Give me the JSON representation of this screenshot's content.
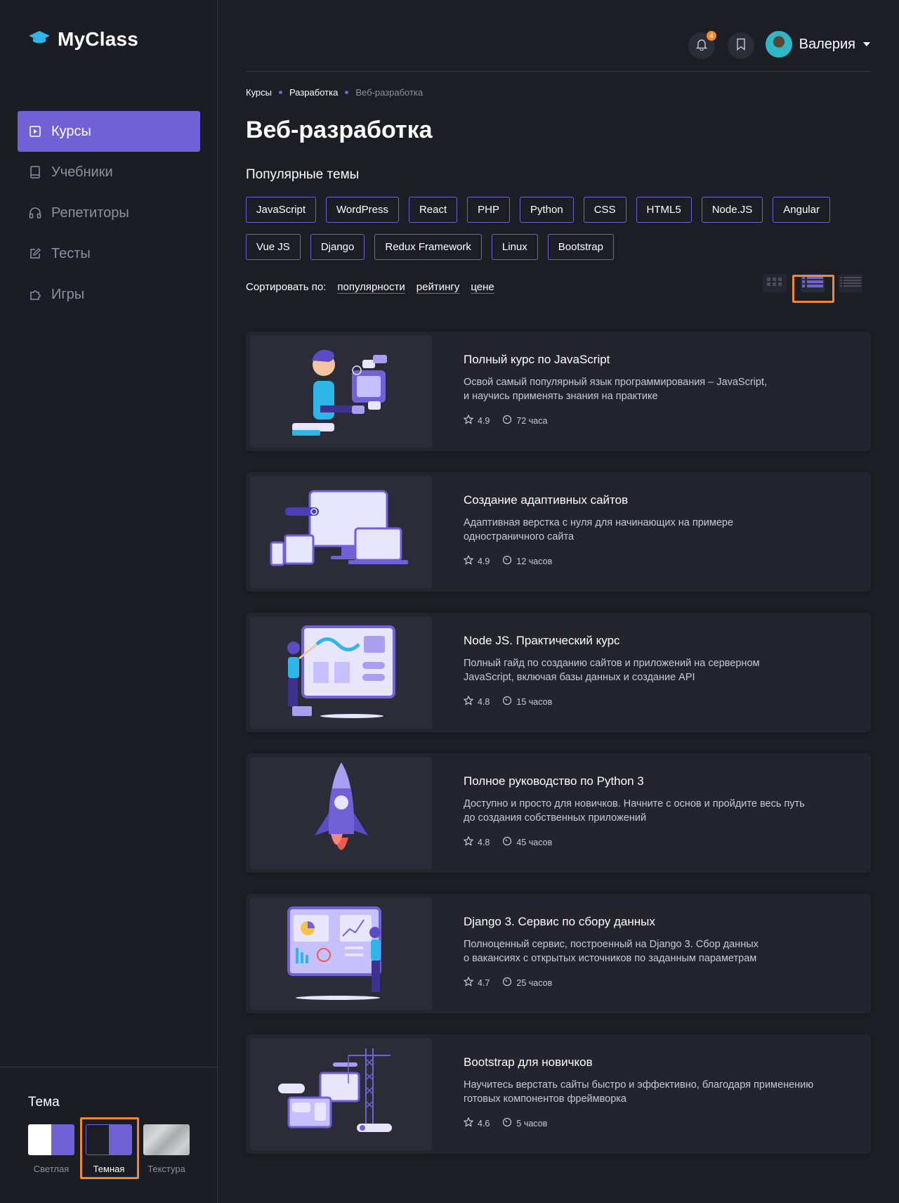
{
  "app": {
    "logo_text": "MyClass"
  },
  "sidebar": {
    "items": [
      {
        "label": "Курсы",
        "icon": "play-square-icon",
        "active": true
      },
      {
        "label": "Учебники",
        "icon": "book-icon",
        "active": false
      },
      {
        "label": "Репетиторы",
        "icon": "headphones-icon",
        "active": false
      },
      {
        "label": "Тесты",
        "icon": "edit-icon",
        "active": false
      },
      {
        "label": "Игры",
        "icon": "puzzle-icon",
        "active": false
      }
    ],
    "theme": {
      "title": "Тема",
      "options": [
        {
          "label": "Светлая",
          "selected": false
        },
        {
          "label": "Темная",
          "selected": true
        },
        {
          "label": "Текстура",
          "selected": false
        }
      ]
    }
  },
  "header": {
    "notification_count": "4",
    "user_name": "Валерия"
  },
  "breadcrumb": [
    "Курсы",
    "Разработка",
    "Веб-разработка"
  ],
  "page_title": "Веб-разработка",
  "topics": {
    "title": "Популярные темы",
    "tags": [
      "JavaScript",
      "WordPress",
      "React",
      "PHP",
      "Python",
      "CSS",
      "HTML5",
      "Node.JS",
      "Angular",
      "Vue JS",
      "Django",
      "Redux Framework",
      "Linux",
      "Bootstrap"
    ]
  },
  "sort": {
    "label": "Сортировать по:",
    "options": [
      "популярности",
      "рейтингу",
      "цене"
    ]
  },
  "view_modes": [
    "grid",
    "list",
    "compact"
  ],
  "courses": [
    {
      "title": "Полный курс по JavaScript",
      "desc1": "Освой самый популярный язык программирования – JavaScript,",
      "desc2": "и научись применять знания на практике",
      "rating": "4.9",
      "duration": "72 часа"
    },
    {
      "title": "Создание адаптивных сайтов",
      "desc1": "Адаптивная верстка с нуля для начинающих на примере",
      "desc2": "одностраничного сайта",
      "rating": "4.9",
      "duration": "12 часов"
    },
    {
      "title": "Node JS. Практический курс",
      "desc1": "Полный гайд по созданию сайтов и приложений на серверном",
      "desc2": "JavaScript, включая базы данных и создание API",
      "rating": "4.8",
      "duration": "15 часов"
    },
    {
      "title": "Полное руководство по Python 3",
      "desc1": "Доступно и просто для новичков. Начните с основ и пройдите весь путь",
      "desc2": "до создания собственных приложений",
      "rating": "4.8",
      "duration": "45 часов"
    },
    {
      "title": "Django 3. Сервис по сбору данных",
      "desc1": "Полноценный сервис, построенный на Django 3. Сбор данных",
      "desc2": "о вакансиях с открытых источников по заданным параметрам",
      "rating": "4.7",
      "duration": "25 часов"
    },
    {
      "title": "Bootstrap для новичков",
      "desc1": "Научитесь верстать сайты быстро и эффективно, благодаря применению",
      "desc2": "готовых компонентов фреймворка",
      "rating": "4.6",
      "duration": "5 часов"
    }
  ],
  "colors": {
    "accent": "#7161d6",
    "highlight": "#f08a32",
    "background": "#1d1e25",
    "card": "#23242d"
  }
}
